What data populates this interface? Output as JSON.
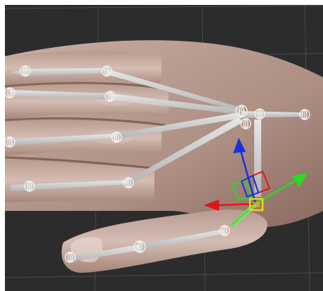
{
  "viewport": {
    "background": "#2c2c2c",
    "frame_color": "#ffffff",
    "grid_color": "#4a4a4a"
  },
  "model": {
    "subject": "hand",
    "skin_light": "#d7c0b6",
    "skin_mid": "#a98577",
    "skin_dark": "#6e4d43"
  },
  "rig": {
    "bone_color": "#cfcfcf",
    "joint_icon": "joint-circle-icon",
    "joints_count": 15
  },
  "gizmo": {
    "axis_x_color": "#e01616",
    "axis_y_color": "#22dd22",
    "axis_z_color": "#1a2fe0",
    "selected_color": "#f1d21b",
    "icons": [
      "move-arrow-x-icon",
      "move-arrow-y-icon",
      "move-arrow-z-icon",
      "plane-handle-icon",
      "selected-joint-icon"
    ]
  }
}
